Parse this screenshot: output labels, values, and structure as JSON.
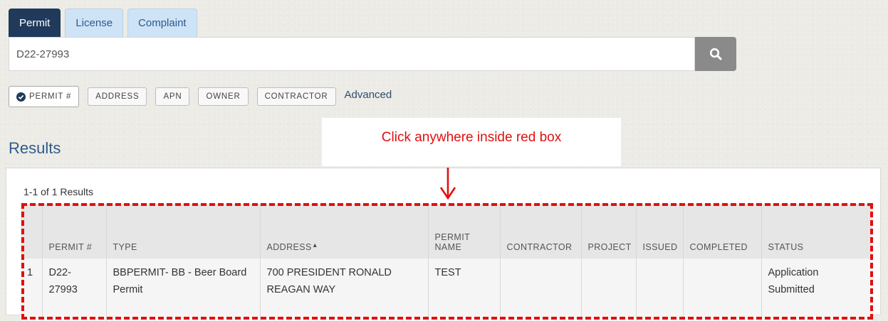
{
  "tabs": [
    {
      "label": "Permit",
      "active": true
    },
    {
      "label": "License",
      "active": false
    },
    {
      "label": "Complaint",
      "active": false
    }
  ],
  "search": {
    "value": "D22-27993",
    "button_icon": "search-icon"
  },
  "filters": {
    "options": [
      "PERMIT #",
      "ADDRESS",
      "APN",
      "OWNER",
      "CONTRACTOR"
    ],
    "selected": "PERMIT #",
    "advanced_label": "Advanced"
  },
  "results": {
    "title": "Results",
    "count": "1-1 of 1 Results",
    "columns": [
      "",
      "PERMIT #",
      "TYPE",
      "ADDRESS",
      "PERMIT NAME",
      "CONTRACTOR",
      "PROJECT",
      "ISSUED",
      "COMPLETED",
      "STATUS"
    ],
    "rows": [
      {
        "index": "1",
        "permit": "D22-27993",
        "type": "BBPERMIT- BB - Beer Board Permit",
        "address": "700 PRESIDENT RONALD REAGAN WAY",
        "permit_name": "TEST",
        "contractor": "",
        "project": "",
        "issued": "",
        "completed": "",
        "status": "Application Submitted"
      }
    ]
  },
  "annotation": {
    "text": "Click anywhere inside red box",
    "color": "#e01010"
  },
  "colors": {
    "active_tab": "#1f3a5a",
    "inactive_tab": "#cfe3f7",
    "accent": "#2e5b8a"
  }
}
